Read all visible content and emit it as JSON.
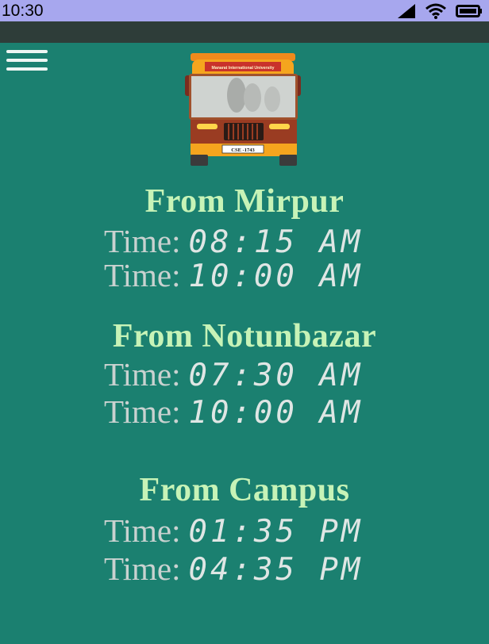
{
  "status_bar": {
    "time": "10:30"
  },
  "bus": {
    "banner": "Manarat International University",
    "plate": "CSE -1743"
  },
  "schedules": [
    {
      "title": "From Mirpur",
      "times": [
        {
          "label": "Time:",
          "value": "08:15 AM"
        },
        {
          "label": "Time:",
          "value": "10:00 AM"
        }
      ]
    },
    {
      "title": "From Notunbazar",
      "times": [
        {
          "label": "Time:",
          "value": "07:30 AM"
        },
        {
          "label": "Time:",
          "value": "10:00 AM"
        }
      ]
    },
    {
      "title": "From Campus",
      "times": [
        {
          "label": "Time:",
          "value": "01:35 PM"
        },
        {
          "label": "Time:",
          "value": "04:35 PM"
        }
      ]
    }
  ]
}
